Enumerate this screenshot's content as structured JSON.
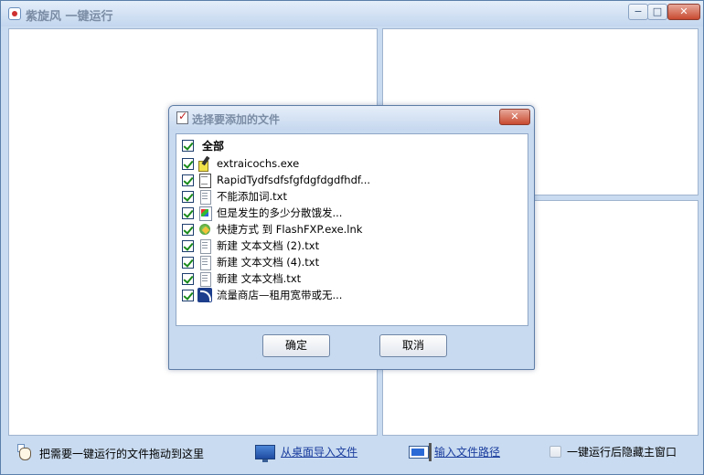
{
  "window": {
    "title": "紫旋风 一键运行",
    "controls": {
      "minimize": "−",
      "maximize": "□",
      "close": "✕"
    }
  },
  "bottom_bar": {
    "drag_hint": "把需要一键运行的文件拖动到这里",
    "import_desktop": "从桌面导入文件",
    "input_path": "输入文件路径",
    "hide_main_window": "一键运行后隐藏主窗口"
  },
  "dialog": {
    "title": "选择要添加的文件",
    "close": "✕",
    "select_all": "全部",
    "files": [
      {
        "name": "extraicochs.exe",
        "icon": "exe-file-icon",
        "checked": true
      },
      {
        "name": "RapidTydfsdfsfgfdgfdgdfhdf...",
        "icon": "document-file-icon",
        "checked": true
      },
      {
        "name": "不能添加词.txt",
        "icon": "text-file-icon",
        "checked": true
      },
      {
        "name": "但是发生的多少分散饿发...",
        "icon": "image-file-icon",
        "checked": true
      },
      {
        "name": "快捷方式 到 FlashFXP.exe.lnk",
        "icon": "shortcut-icon",
        "checked": true
      },
      {
        "name": "新建 文本文档 (2).txt",
        "icon": "text-file-icon",
        "checked": true
      },
      {
        "name": "新建 文本文档 (4).txt",
        "icon": "text-file-icon",
        "checked": true
      },
      {
        "name": "新建 文本文档.txt",
        "icon": "text-file-icon",
        "checked": true
      },
      {
        "name": "流量商店—租用宽带或无...",
        "icon": "rss-feed-icon",
        "checked": true
      }
    ],
    "ok": "确定",
    "cancel": "取消"
  }
}
